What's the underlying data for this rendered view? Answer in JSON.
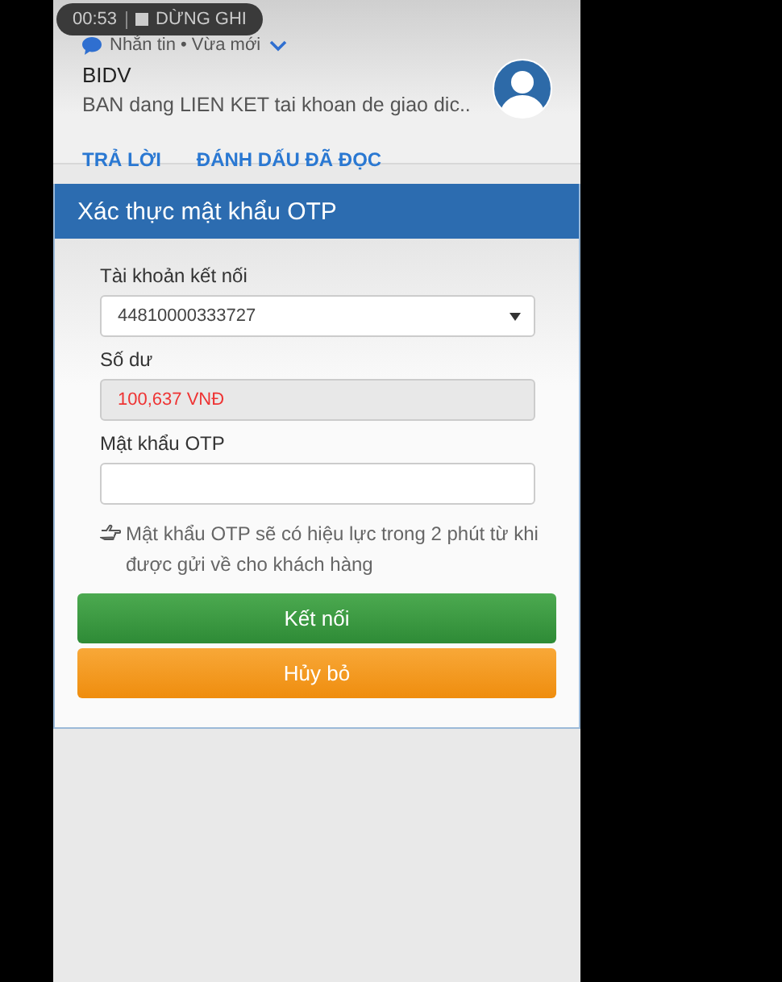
{
  "recording": {
    "time": "00:53",
    "label": "DỪNG GHI"
  },
  "notification": {
    "app": "Nhắn tin • Vừa mới",
    "sender": "BIDV",
    "message": "BAN dang LIEN KET tai khoan de giao dic..",
    "actions": [
      "TRẢ LỜI",
      "ĐÁNH DẤU ĐÃ ĐỌC"
    ]
  },
  "dialog": {
    "title": "Xác thực mật khẩu OTP",
    "account": {
      "label": "Tài khoản kết nối",
      "value": "44810000333727"
    },
    "balance": {
      "label": "Số dư",
      "value": "100,637 VNĐ"
    },
    "otp": {
      "label": "Mật khẩu OTP"
    },
    "hint": "Mật khẩu OTP sẽ có hiệu lực trong 2 phút từ khi được gửi về cho khách hàng",
    "buttons": [
      {
        "label": "Kết nối",
        "kind": "primary"
      },
      {
        "label": "Hủy bỏ",
        "kind": "cancel"
      }
    ]
  }
}
